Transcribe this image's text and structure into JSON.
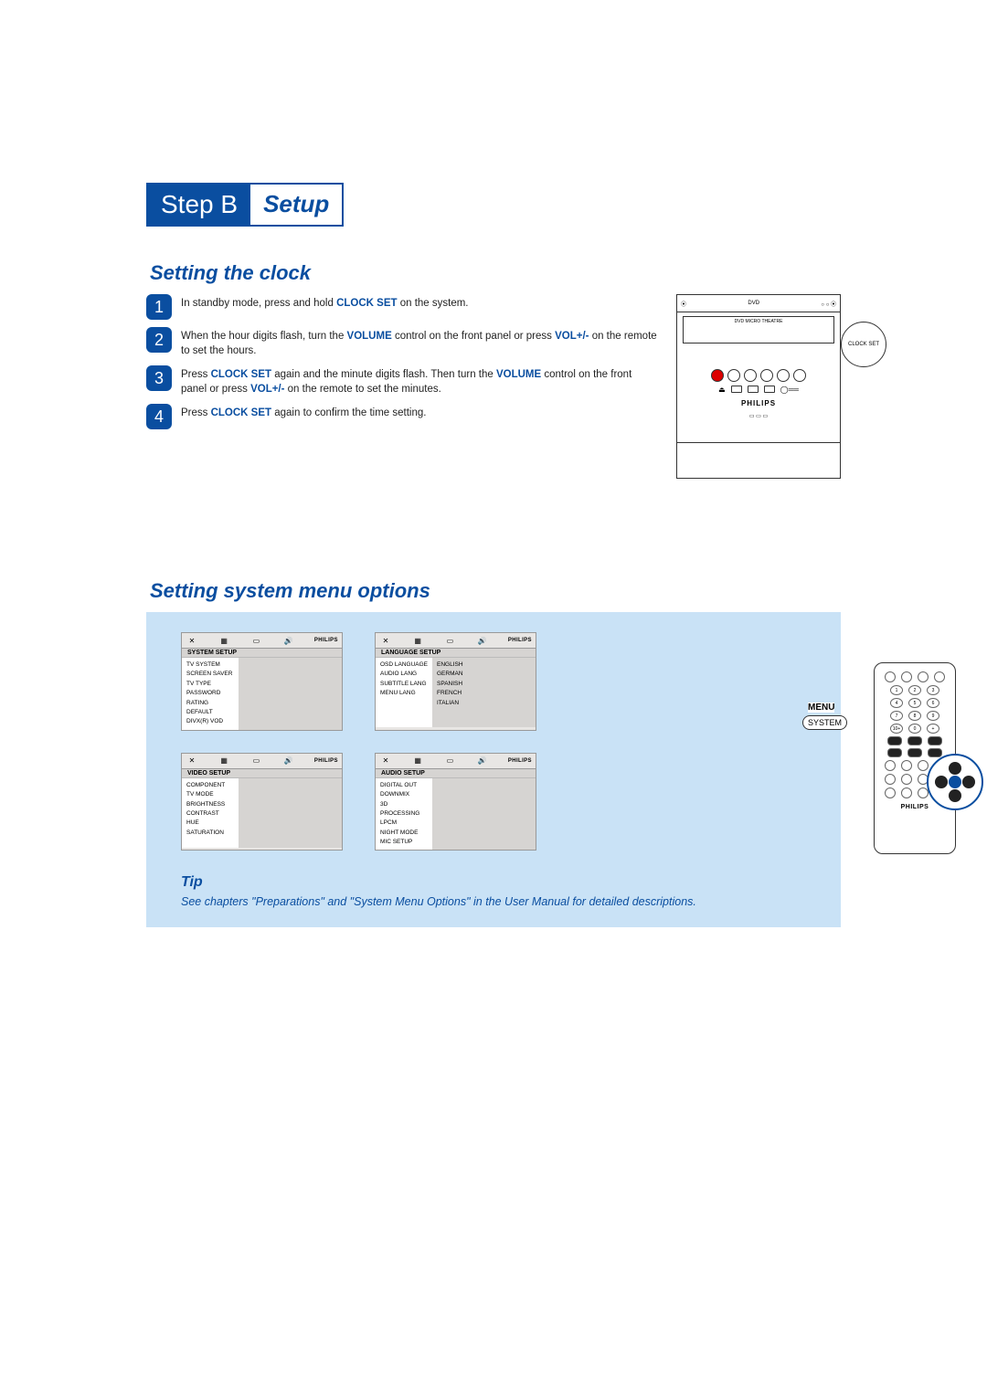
{
  "header": {
    "step_label": "Step B",
    "step_sub": "Setup"
  },
  "clock_section": {
    "title": "Setting the clock",
    "steps": [
      {
        "num": "1",
        "pre": "In standby mode, press and hold ",
        "kw": "CLOCK SET",
        "post": " on the system."
      },
      {
        "num": "2",
        "pre": "When the hour digits flash, turn the ",
        "kw": "VOLUME",
        "mid": " control on the front panel or press ",
        "kw2": "VOL+/-",
        "post": " on the remote to set the hours."
      },
      {
        "num": "3",
        "pre": "Press ",
        "kw": "CLOCK SET",
        "mid": " again and the minute digits flash. Then turn the ",
        "kw2": "VOLUME",
        "mid2": " control on the front panel or press ",
        "kw3": "VOL+/-",
        "post": " on the remote to set the minutes."
      },
      {
        "num": "4",
        "pre": "Press ",
        "kw": "CLOCK SET",
        "post": " again to confirm the time setting."
      }
    ],
    "device": {
      "top_label": "DVD",
      "screen_label": "DVD MICRO THEATRE",
      "brand": "PHILIPS",
      "callout": "CLOCK SET"
    }
  },
  "menu_section": {
    "title": "Setting system menu options",
    "brand": "PHILIPS",
    "menus": [
      {
        "title": "SYSTEM SETUP",
        "left": [
          "TV SYSTEM",
          "SCREEN SAVER",
          "TV TYPE",
          "PASSWORD",
          "RATING",
          "DEFAULT",
          "DIVX(R) VOD"
        ],
        "right": []
      },
      {
        "title": "LANGUAGE SETUP",
        "left": [
          "OSD LANGUAGE",
          "AUDIO LANG",
          "SUBTITLE LANG",
          "MENU LANG"
        ],
        "right": [
          "ENGLISH",
          "GERMAN",
          "SPANISH",
          "FRENCH",
          "ITALIAN"
        ]
      },
      {
        "title": "VIDEO SETUP",
        "left": [
          "COMPONENT",
          "TV MODE",
          "BRIGHTNESS",
          "CONTRAST",
          "HUE",
          "SATURATION"
        ],
        "right": []
      },
      {
        "title": "AUDIO SETUP",
        "left": [
          "DIGITAL OUT",
          "DOWNMIX",
          "3D PROCESSING",
          "LPCM",
          "NIGHT MODE",
          "MIC SETUP"
        ],
        "right": []
      }
    ],
    "tip": {
      "title": "Tip",
      "text": "See chapters \"Preparations\" and \"System Menu Options\" in the User Manual for detailed descriptions."
    },
    "remote": {
      "menu_label": "MENU",
      "system_label": "SYSTEM",
      "brand": "PHILIPS",
      "num_rows": [
        [
          "1",
          "2",
          "3"
        ],
        [
          "4",
          "5",
          "6"
        ],
        [
          "7",
          "8",
          "9"
        ],
        [
          "10+",
          "0",
          "+"
        ]
      ]
    }
  }
}
